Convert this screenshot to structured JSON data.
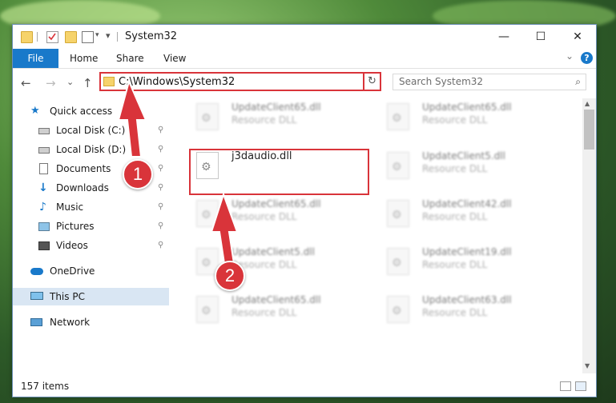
{
  "window": {
    "title": "System32",
    "min": "—",
    "max": "☐",
    "close": "✕"
  },
  "ribbon": {
    "file": "File",
    "tabs": [
      "Home",
      "Share",
      "View"
    ],
    "help": "?",
    "expand": "⌄"
  },
  "nav": {
    "back": "←",
    "forward": "→",
    "recent": "⌄",
    "up": "↑",
    "address": "C:\\Windows\\System32",
    "refresh": "↻",
    "search_placeholder": "Search System32",
    "search_glyph": "⌕"
  },
  "sidebar": {
    "items": [
      {
        "label": "Quick access",
        "icon": "star-icon",
        "pinned": false
      },
      {
        "label": "Local Disk (C:)",
        "icon": "drive-icon",
        "pinned": true
      },
      {
        "label": "Local Disk (D:)",
        "icon": "drive-icon",
        "pinned": true
      },
      {
        "label": "Documents",
        "icon": "documents-icon",
        "pinned": true
      },
      {
        "label": "Downloads",
        "icon": "downloads-icon",
        "pinned": true
      },
      {
        "label": "Music",
        "icon": "music-icon",
        "pinned": true
      },
      {
        "label": "Pictures",
        "icon": "pictures-icon",
        "pinned": true
      },
      {
        "label": "Videos",
        "icon": "videos-icon",
        "pinned": true
      },
      {
        "label": "OneDrive",
        "icon": "cloud-icon",
        "pinned": false
      },
      {
        "label": "This PC",
        "icon": "computer-icon",
        "pinned": false
      },
      {
        "label": "Network",
        "icon": "network-icon",
        "pinned": false
      }
    ],
    "pin_glyph": "📌"
  },
  "files": {
    "highlighted": {
      "name": "j3daudio.dll",
      "type": ""
    },
    "blurred": [
      {
        "name": "UpdateClient65.dll",
        "type": "Resource DLL"
      },
      {
        "name": "UpdateClient65.dll",
        "type": "Resource DLL"
      },
      {
        "name": "UpdateClient5.dll",
        "type": "Resource DLL"
      },
      {
        "name": "UpdateClient65.dll",
        "type": "Resource DLL"
      },
      {
        "name": "UpdateClient42.dll",
        "type": "Resource DLL"
      },
      {
        "name": "UpdateClient5.dll",
        "type": "Resource DLL"
      },
      {
        "name": "UpdateClient19.dll",
        "type": "Resource DLL"
      },
      {
        "name": "UpdateClient65.dll",
        "type": "Resource DLL"
      },
      {
        "name": "UpdateClient63.dll",
        "type": "Resource DLL"
      }
    ],
    "gear_glyph": "⚙"
  },
  "status": {
    "items": "157 items"
  },
  "annotations": {
    "step1": "1",
    "step2": "2"
  },
  "colors": {
    "accent": "#1979ca",
    "highlight": "#d9343a",
    "selected": "#d9e6f3"
  }
}
